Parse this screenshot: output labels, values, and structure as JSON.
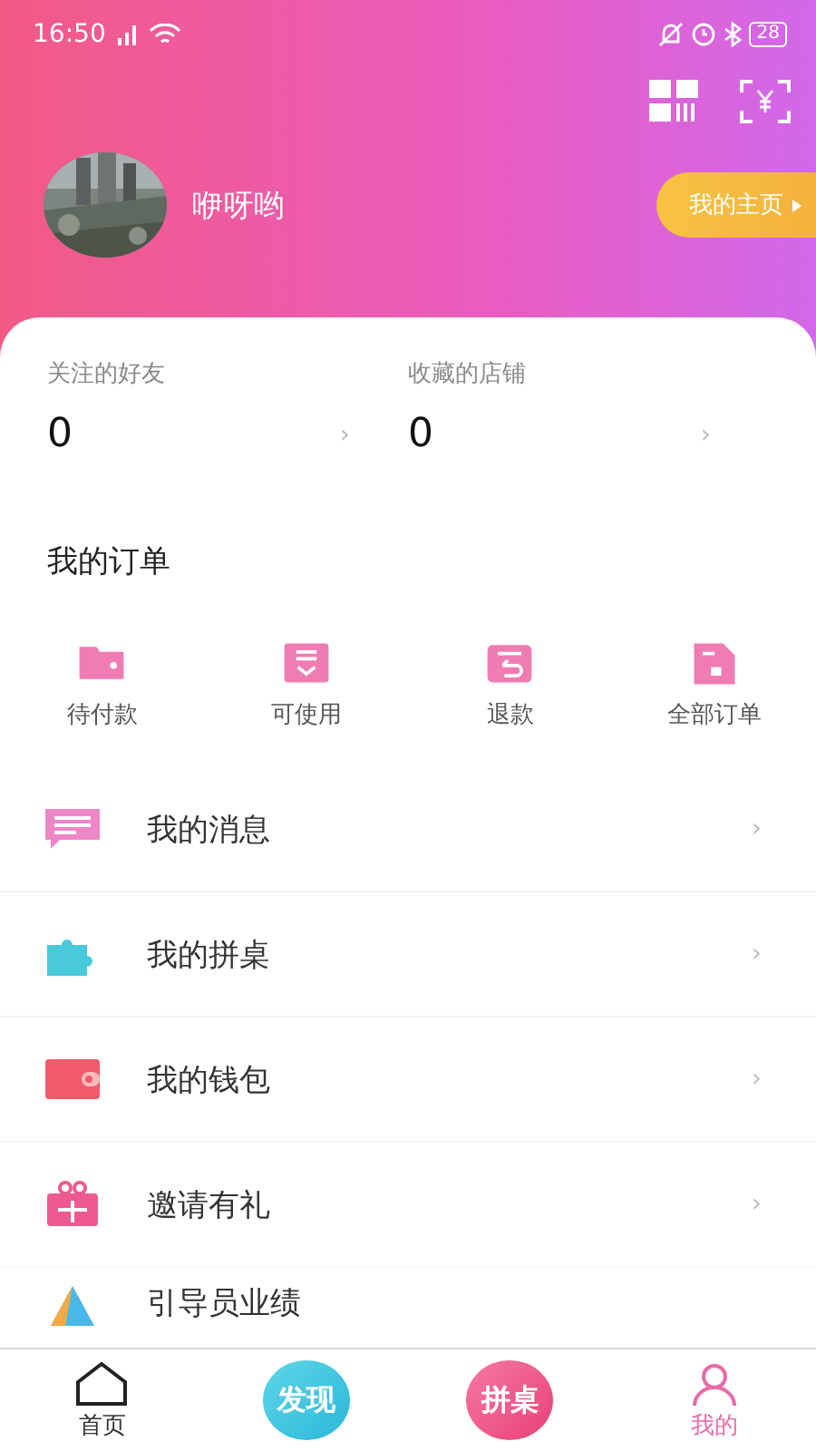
{
  "status_bar": {
    "time": "16:50",
    "battery": "28"
  },
  "profile": {
    "name": "咿呀哟",
    "home_button": "我的主页"
  },
  "stats": [
    {
      "label": "关注的好友",
      "value": "0",
      "chevron": "›"
    },
    {
      "label": "收藏的店铺",
      "value": "0",
      "chevron": "›"
    }
  ],
  "orders": {
    "title": "我的订单",
    "items": [
      {
        "kind": "pay",
        "label": "待付款"
      },
      {
        "kind": "usable",
        "label": "可使用"
      },
      {
        "kind": "refund",
        "label": "退款"
      },
      {
        "kind": "all",
        "label": "全部订单"
      }
    ]
  },
  "menu": [
    {
      "kind": "message",
      "label": "我的消息",
      "chevron": "›"
    },
    {
      "kind": "puzzle",
      "label": "我的拼桌",
      "chevron": "›"
    },
    {
      "kind": "wallet",
      "label": "我的钱包",
      "chevron": "›"
    },
    {
      "kind": "gift",
      "label": "邀请有礼",
      "chevron": "›"
    },
    {
      "kind": "guide",
      "label": "引导员业绩"
    }
  ],
  "tab_bar": [
    {
      "kind": "home",
      "label": "首页",
      "selected": false
    },
    {
      "kind": "discover",
      "label": "发现",
      "selected": false
    },
    {
      "kind": "table",
      "label": "拼桌",
      "selected": false
    },
    {
      "kind": "me",
      "label": "我的",
      "selected": true
    }
  ]
}
